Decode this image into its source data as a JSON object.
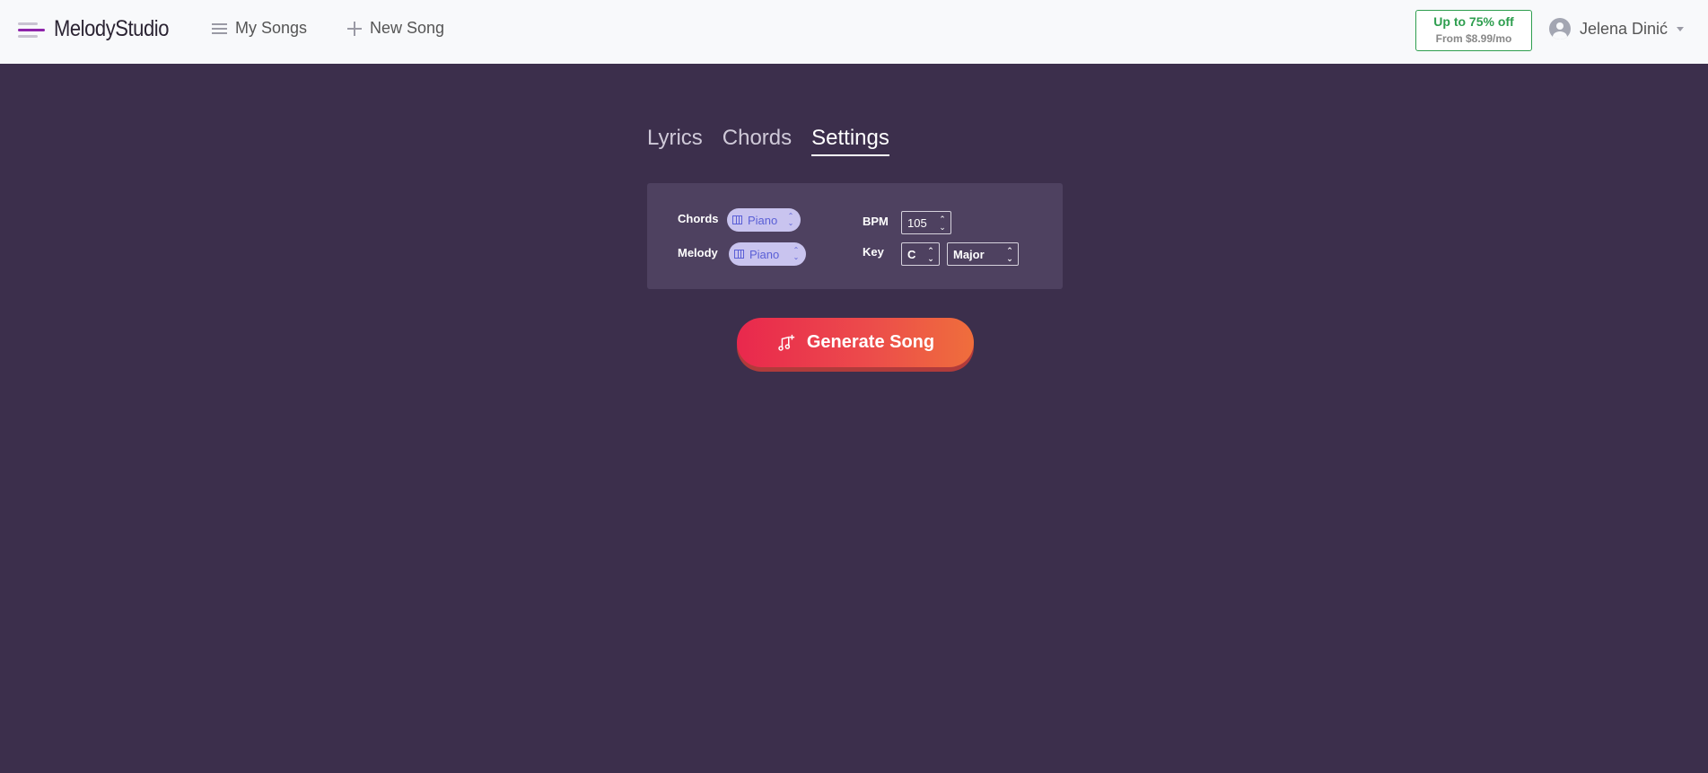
{
  "app": {
    "name": "MelodyStudio"
  },
  "nav": {
    "my_songs": "My Songs",
    "new_song": "New Song"
  },
  "promo": {
    "main": "Up to 75% off",
    "sub": "From $8.99/mo"
  },
  "user": {
    "name": "Jelena Dinić"
  },
  "tabs": [
    {
      "label": "Lyrics",
      "active": false
    },
    {
      "label": "Chords",
      "active": false
    },
    {
      "label": "Settings",
      "active": true
    }
  ],
  "settings": {
    "chords_label": "Chords",
    "chords_instrument": "Piano",
    "melody_label": "Melody",
    "melody_instrument": "Piano",
    "bpm_label": "BPM",
    "bpm_value": "105",
    "key_label": "Key",
    "key_note": "C",
    "key_mode": "Major"
  },
  "generate": {
    "label": "Generate Song"
  },
  "colors": {
    "background": "#3c2f4c",
    "panel": "#4e4160",
    "brand_purple": "#8e24aa",
    "promo_green": "#2e9e4f",
    "pill_bg": "#c9c4ef",
    "pill_text": "#5a5fd6",
    "button_gradient_start": "#e9284d",
    "button_gradient_end": "#ef6e3c"
  },
  "icons": [
    "logo-icon",
    "list-icon",
    "plus-icon",
    "avatar-icon",
    "chevron-down-icon",
    "piano-icon",
    "updown-icon",
    "music-note-plus-icon"
  ]
}
